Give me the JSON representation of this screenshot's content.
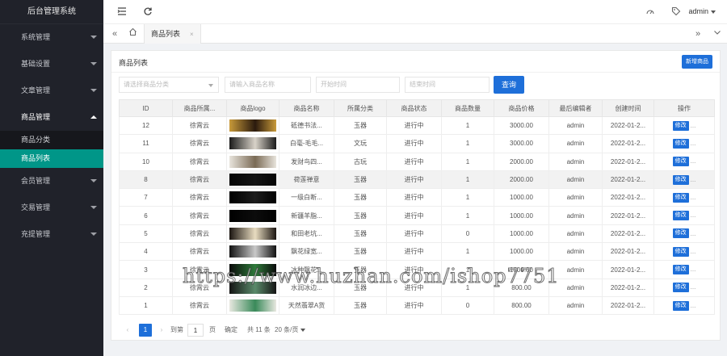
{
  "sidebar": {
    "brand": "后台管理系统",
    "menus": [
      {
        "label": "系统管理",
        "open": false
      },
      {
        "label": "基础设置",
        "open": false
      },
      {
        "label": "文章管理",
        "open": false
      },
      {
        "label": "商品管理",
        "open": true,
        "children": [
          {
            "label": "商品分类",
            "active": false
          },
          {
            "label": "商品列表",
            "active": true
          }
        ]
      },
      {
        "label": "会员管理",
        "open": false
      },
      {
        "label": "交易管理",
        "open": false
      },
      {
        "label": "充提管理",
        "open": false
      }
    ]
  },
  "header": {
    "user": "admin",
    "icons": [
      "menu-fold-icon",
      "refresh-icon",
      "theme-icon",
      "tag-icon"
    ]
  },
  "tabs": {
    "active_label": "商品列表",
    "close_glyph": "×"
  },
  "card": {
    "title": "商品列表",
    "add_button": "新增商品"
  },
  "filters": {
    "category_placeholder": "请选择商品分类",
    "name_placeholder": "请输入商品名称",
    "start_placeholder": "开始时间",
    "end_placeholder": "结束时间",
    "query_button": "查询"
  },
  "table": {
    "columns": [
      "ID",
      "商品所属...",
      "商品logo",
      "商品名称",
      "所属分类",
      "商品状态",
      "商品数量",
      "商品价格",
      "最后编辑者",
      "创建时间",
      "操作"
    ],
    "rows": [
      {
        "id": "12",
        "owner": "徐霄云",
        "name": "砥德书法...",
        "category": "玉器",
        "status": "进行中",
        "qty": "1",
        "price": "3000.00",
        "editor": "admin",
        "created": "2022-01-2...",
        "thumb": [
          "#c89a3a",
          "#2b1a0e"
        ],
        "highlight": false
      },
      {
        "id": "11",
        "owner": "徐霄云",
        "name": "白毫-毛毛...",
        "category": "文玩",
        "status": "进行中",
        "qty": "1",
        "price": "3000.00",
        "editor": "admin",
        "created": "2022-01-2...",
        "thumb": [
          "#1a1a1a",
          "#d8d2c8"
        ],
        "highlight": false
      },
      {
        "id": "10",
        "owner": "徐霄云",
        "name": "发财鸟四...",
        "category": "古玩",
        "status": "进行中",
        "qty": "1",
        "price": "2000.00",
        "editor": "admin",
        "created": "2022-01-2...",
        "thumb": [
          "#e8e4dc",
          "#7a6a55"
        ],
        "highlight": false
      },
      {
        "id": "8",
        "owner": "徐霄云",
        "name": "荷莲禅意",
        "category": "玉器",
        "status": "进行中",
        "qty": "1",
        "price": "2000.00",
        "editor": "admin",
        "created": "2022-01-2...",
        "thumb": [
          "#050505",
          "#141414"
        ],
        "highlight": true
      },
      {
        "id": "7",
        "owner": "徐霄云",
        "name": "一级白断...",
        "category": "玉器",
        "status": "进行中",
        "qty": "1",
        "price": "1000.00",
        "editor": "admin",
        "created": "2022-01-2...",
        "thumb": [
          "#000000",
          "#1c1c1c"
        ],
        "highlight": false
      },
      {
        "id": "6",
        "owner": "徐霄云",
        "name": "新疆羊脂...",
        "category": "玉器",
        "status": "进行中",
        "qty": "1",
        "price": "1000.00",
        "editor": "admin",
        "created": "2022-01-2...",
        "thumb": [
          "#000000",
          "#0c0c0c"
        ],
        "highlight": false
      },
      {
        "id": "5",
        "owner": "徐霄云",
        "name": "和田老坑...",
        "category": "玉器",
        "status": "进行中",
        "qty": "0",
        "price": "1000.00",
        "editor": "admin",
        "created": "2022-01-2...",
        "thumb": [
          "#1a1410",
          "#e8dcc0"
        ],
        "highlight": false
      },
      {
        "id": "4",
        "owner": "徐霄云",
        "name": "飘花绿宽...",
        "category": "玉器",
        "status": "进行中",
        "qty": "1",
        "price": "1000.00",
        "editor": "admin",
        "created": "2022-01-2...",
        "thumb": [
          "#101010",
          "#c8c8c8"
        ],
        "highlight": false
      },
      {
        "id": "3",
        "owner": "徐霄云",
        "name": "冰种飘花...",
        "category": "玉器",
        "status": "进行中",
        "qty": "1",
        "price": "1000.00",
        "editor": "admin",
        "created": "2022-01-2...",
        "thumb": [
          "#0a0a0a",
          "#2e7a3a"
        ],
        "highlight": false
      },
      {
        "id": "2",
        "owner": "徐霄云",
        "name": "水润冰边...",
        "category": "玉器",
        "status": "进行中",
        "qty": "1",
        "price": "800.00",
        "editor": "admin",
        "created": "2022-01-2...",
        "thumb": [
          "#141414",
          "#5a8a6a"
        ],
        "highlight": false
      },
      {
        "id": "1",
        "owner": "徐霄云",
        "name": "天然翡翠A货",
        "category": "玉器",
        "status": "进行中",
        "qty": "0",
        "price": "800.00",
        "editor": "admin",
        "created": "2022-01-2...",
        "thumb": [
          "#e8e8e0",
          "#3a8a5a"
        ],
        "highlight": false
      }
    ],
    "edit_label": "修改",
    "more_label": "..."
  },
  "pagination": {
    "current": "1",
    "goto_label": "到第",
    "goto_value": "1",
    "page_unit": "页",
    "confirm": "确定",
    "total": "共 11 条",
    "page_size": "20 条/页"
  },
  "watermark": "https://www.huzhan.com/ishop7751",
  "colors": {
    "sidebar_bg": "#20222a",
    "active_submenu": "#009688",
    "primary_button": "#1e6fd9"
  }
}
